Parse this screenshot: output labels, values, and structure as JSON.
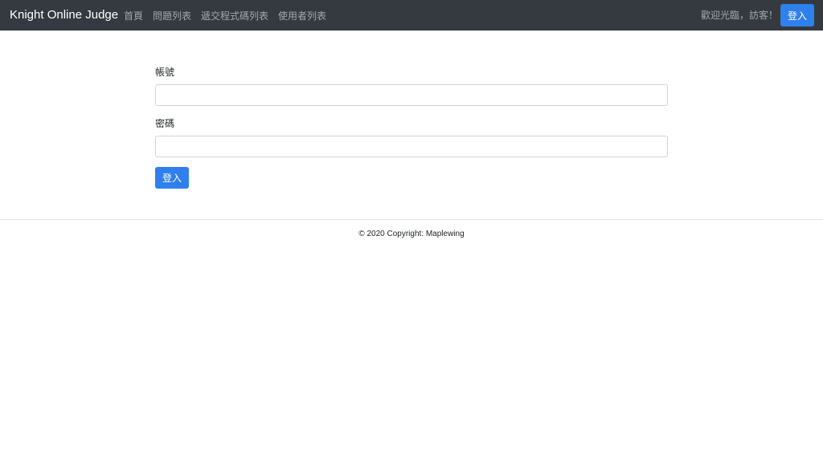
{
  "navbar": {
    "brand": "Knight Online Judge",
    "links": [
      "首頁",
      "問題列表",
      "遞交程式碼列表",
      "使用者列表"
    ],
    "welcome": "歡迎光臨，訪客！",
    "login_label": "登入"
  },
  "form": {
    "username_label": "帳號",
    "username_value": "",
    "password_label": "密碼",
    "password_value": "",
    "submit_label": "登入"
  },
  "footer": {
    "text": "© 2020 Copyright: Maplewing"
  },
  "colors": {
    "navbar_bg": "#343a40",
    "primary": "#2f80ed"
  }
}
